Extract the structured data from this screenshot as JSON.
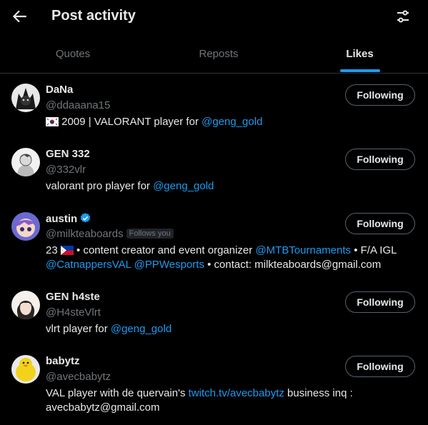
{
  "header": {
    "title": "Post activity",
    "back_icon": "arrow-left-icon",
    "filter_icon": "sliders-icon"
  },
  "tabs": [
    {
      "label": "Quotes",
      "active": false
    },
    {
      "label": "Reposts",
      "active": false
    },
    {
      "label": "Likes",
      "active": true
    }
  ],
  "colors": {
    "accent": "#1d9bf0",
    "muted": "#71767b",
    "text": "#e7e9ea",
    "border": "#2f3336",
    "background": "#000000"
  },
  "users": [
    {
      "name": "DaNa",
      "handle": "@ddaaana15",
      "button": "Following",
      "bio": {
        "flag": "KR",
        "t1": "2009 | VALORANT player for ",
        "l1": "@geng_gold"
      }
    },
    {
      "name": "GEN 332",
      "handle": "@332vlr",
      "button": "Following",
      "bio": {
        "t1": "valorant pro player for ",
        "l1": "@geng_gold"
      }
    },
    {
      "name": "austin",
      "verified": true,
      "handle": "@milkteaboards",
      "follows_you": "Follows you",
      "button": "Following",
      "bio": {
        "t1": "23 ",
        "flag": "PH",
        "t2": " • content creator and event organizer ",
        "l1": "@MTBTournaments",
        "t3": " • F/A IGL",
        "l2": "@CatnappersVAL",
        "l3": "@PPWesports",
        "t4": " • contact: milkteaboards@gmail.com"
      }
    },
    {
      "name": "GEN h4ste",
      "handle": "@H4steVlrt",
      "button": "Following",
      "bio": {
        "t1": "vlrt player for ",
        "l1": "@geng_gold"
      }
    },
    {
      "name": "babytz",
      "handle": "@avecbabytz",
      "button": "Following",
      "bio": {
        "t1": "VAL player with de quervain's ",
        "l1": "twitch.tv/avecbabytz",
        "t2": " business inq :",
        "t3": "avecbabytz@gmail.com"
      }
    }
  ]
}
